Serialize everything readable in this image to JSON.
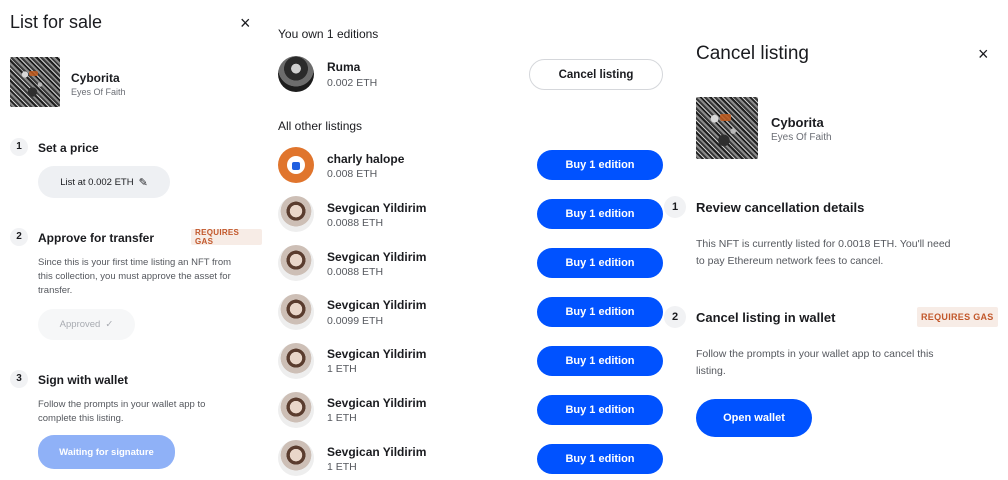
{
  "list_for_sale": {
    "title": "List for sale",
    "close_icon": "×",
    "nft": {
      "name": "Cyborita",
      "collection": "Eyes Of Faith"
    },
    "steps": [
      {
        "number": "1",
        "title": "Set a price",
        "button": "List at 0.002 ETH",
        "button_icon": "✎"
      },
      {
        "number": "2",
        "title": "Approve for transfer",
        "badge": "REQUIRES GAS",
        "desc_lines": [
          "Since this is your first time listing an NFT from",
          "this collection, you must approve the asset for",
          "transfer."
        ],
        "button": "Approved",
        "button_icon": "✓"
      },
      {
        "number": "3",
        "title": "Sign with wallet",
        "desc_lines": [
          "Follow the prompts in your wallet app to",
          "complete this listing."
        ],
        "button": "Waiting for signature"
      }
    ]
  },
  "editions": {
    "own_heading": "You own 1 editions",
    "own": {
      "name": "Ruma",
      "price": "0.002 ETH",
      "button": "Cancel listing"
    },
    "other_heading": "All other listings",
    "listings": [
      {
        "name": "charly halope",
        "price": "0.008 ETH",
        "button": "Buy 1 edition"
      },
      {
        "name": "Sevgican Yildirim",
        "price": "0.0088 ETH",
        "button": "Buy 1 edition"
      },
      {
        "name": "Sevgican Yildirim",
        "price": "0.0088 ETH",
        "button": "Buy 1 edition"
      },
      {
        "name": "Sevgican Yildirim",
        "price": "0.0099 ETH",
        "button": "Buy 1 edition"
      },
      {
        "name": "Sevgican Yildirim",
        "price": "1 ETH",
        "button": "Buy 1 edition"
      },
      {
        "name": "Sevgican Yildirim",
        "price": "1 ETH",
        "button": "Buy 1 edition"
      },
      {
        "name": "Sevgican Yildirim",
        "price": "1 ETH",
        "button": "Buy 1 edition"
      }
    ]
  },
  "cancel_listing": {
    "title": "Cancel listing",
    "close_icon": "×",
    "nft": {
      "name": "Cyborita",
      "collection": "Eyes Of Faith"
    },
    "steps": [
      {
        "number": "1",
        "title": "Review cancellation details",
        "desc_lines": [
          "This NFT is currently listed for 0.0018 ETH. You'll need",
          "to pay Ethereum network fees to cancel."
        ]
      },
      {
        "number": "2",
        "title": "Cancel listing in wallet",
        "badge": "REQUIRES GAS",
        "desc_lines": [
          "Follow the prompts in your wallet app to cancel this",
          "listing."
        ]
      }
    ],
    "button": "Open wallet"
  },
  "colors": {
    "primary_blue": "#0052ff",
    "disabled_blue": "#8fb1f7",
    "badge_text": "#c2572a",
    "badge_bg": "#f7ece6"
  }
}
